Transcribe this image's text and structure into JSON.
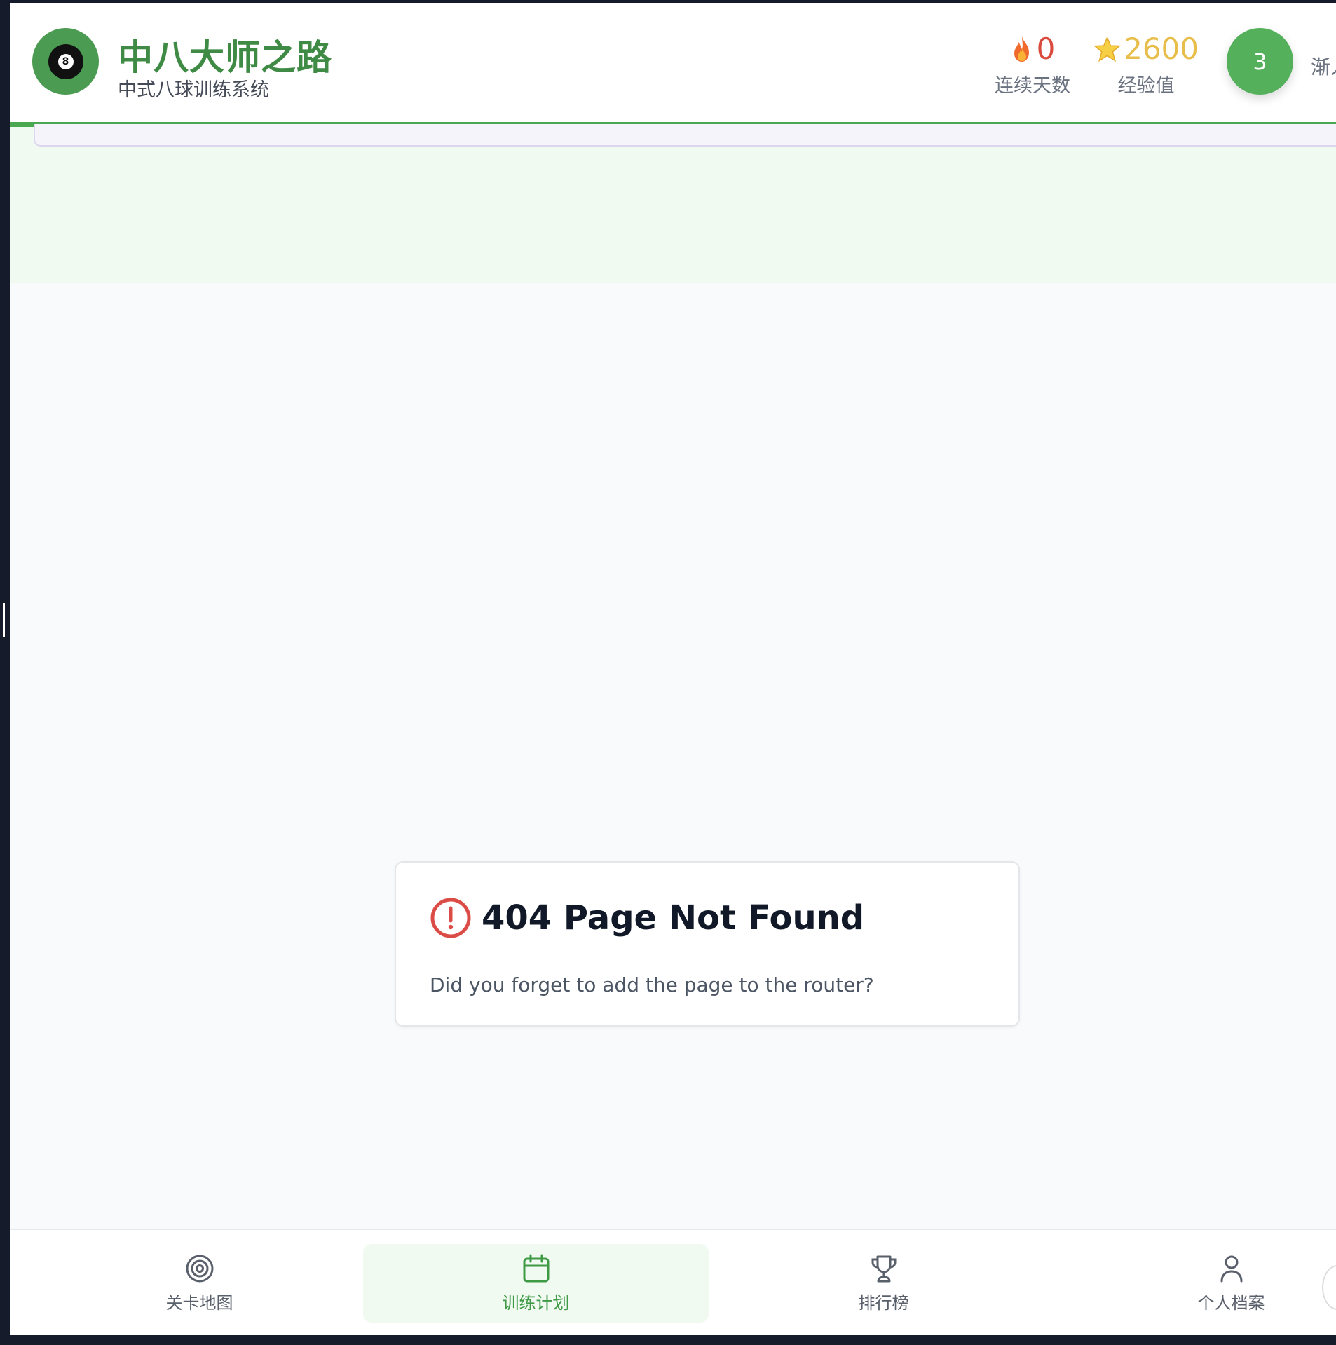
{
  "header": {
    "logo_ball_number": "8",
    "title": "中八大师之路",
    "subtitle": "中式八球训练系统",
    "streak": {
      "icon": "flame-icon",
      "value": "0",
      "label": "连续天数"
    },
    "xp": {
      "icon": "star-icon",
      "value": "2600",
      "label": "经验值"
    },
    "level": {
      "value": "3",
      "title": "渐入"
    }
  },
  "error": {
    "icon": "alert-circle-icon",
    "title": "404 Page Not Found",
    "message": "Did you forget to add the page to the router?"
  },
  "bottom_nav": [
    {
      "label": "关卡地图",
      "icon": "target-icon",
      "active": false
    },
    {
      "label": "训练计划",
      "icon": "calendar-icon",
      "active": true
    },
    {
      "label": "排行榜",
      "icon": "trophy-icon",
      "active": false
    },
    {
      "label": "个人档案",
      "icon": "user-icon",
      "active": false
    }
  ],
  "colors": {
    "brand_green": "#3f8b45",
    "accent_green": "#4aa851",
    "streak_red": "#d94c3d",
    "xp_gold": "#e8be4a",
    "error_red": "#dc4c46"
  }
}
